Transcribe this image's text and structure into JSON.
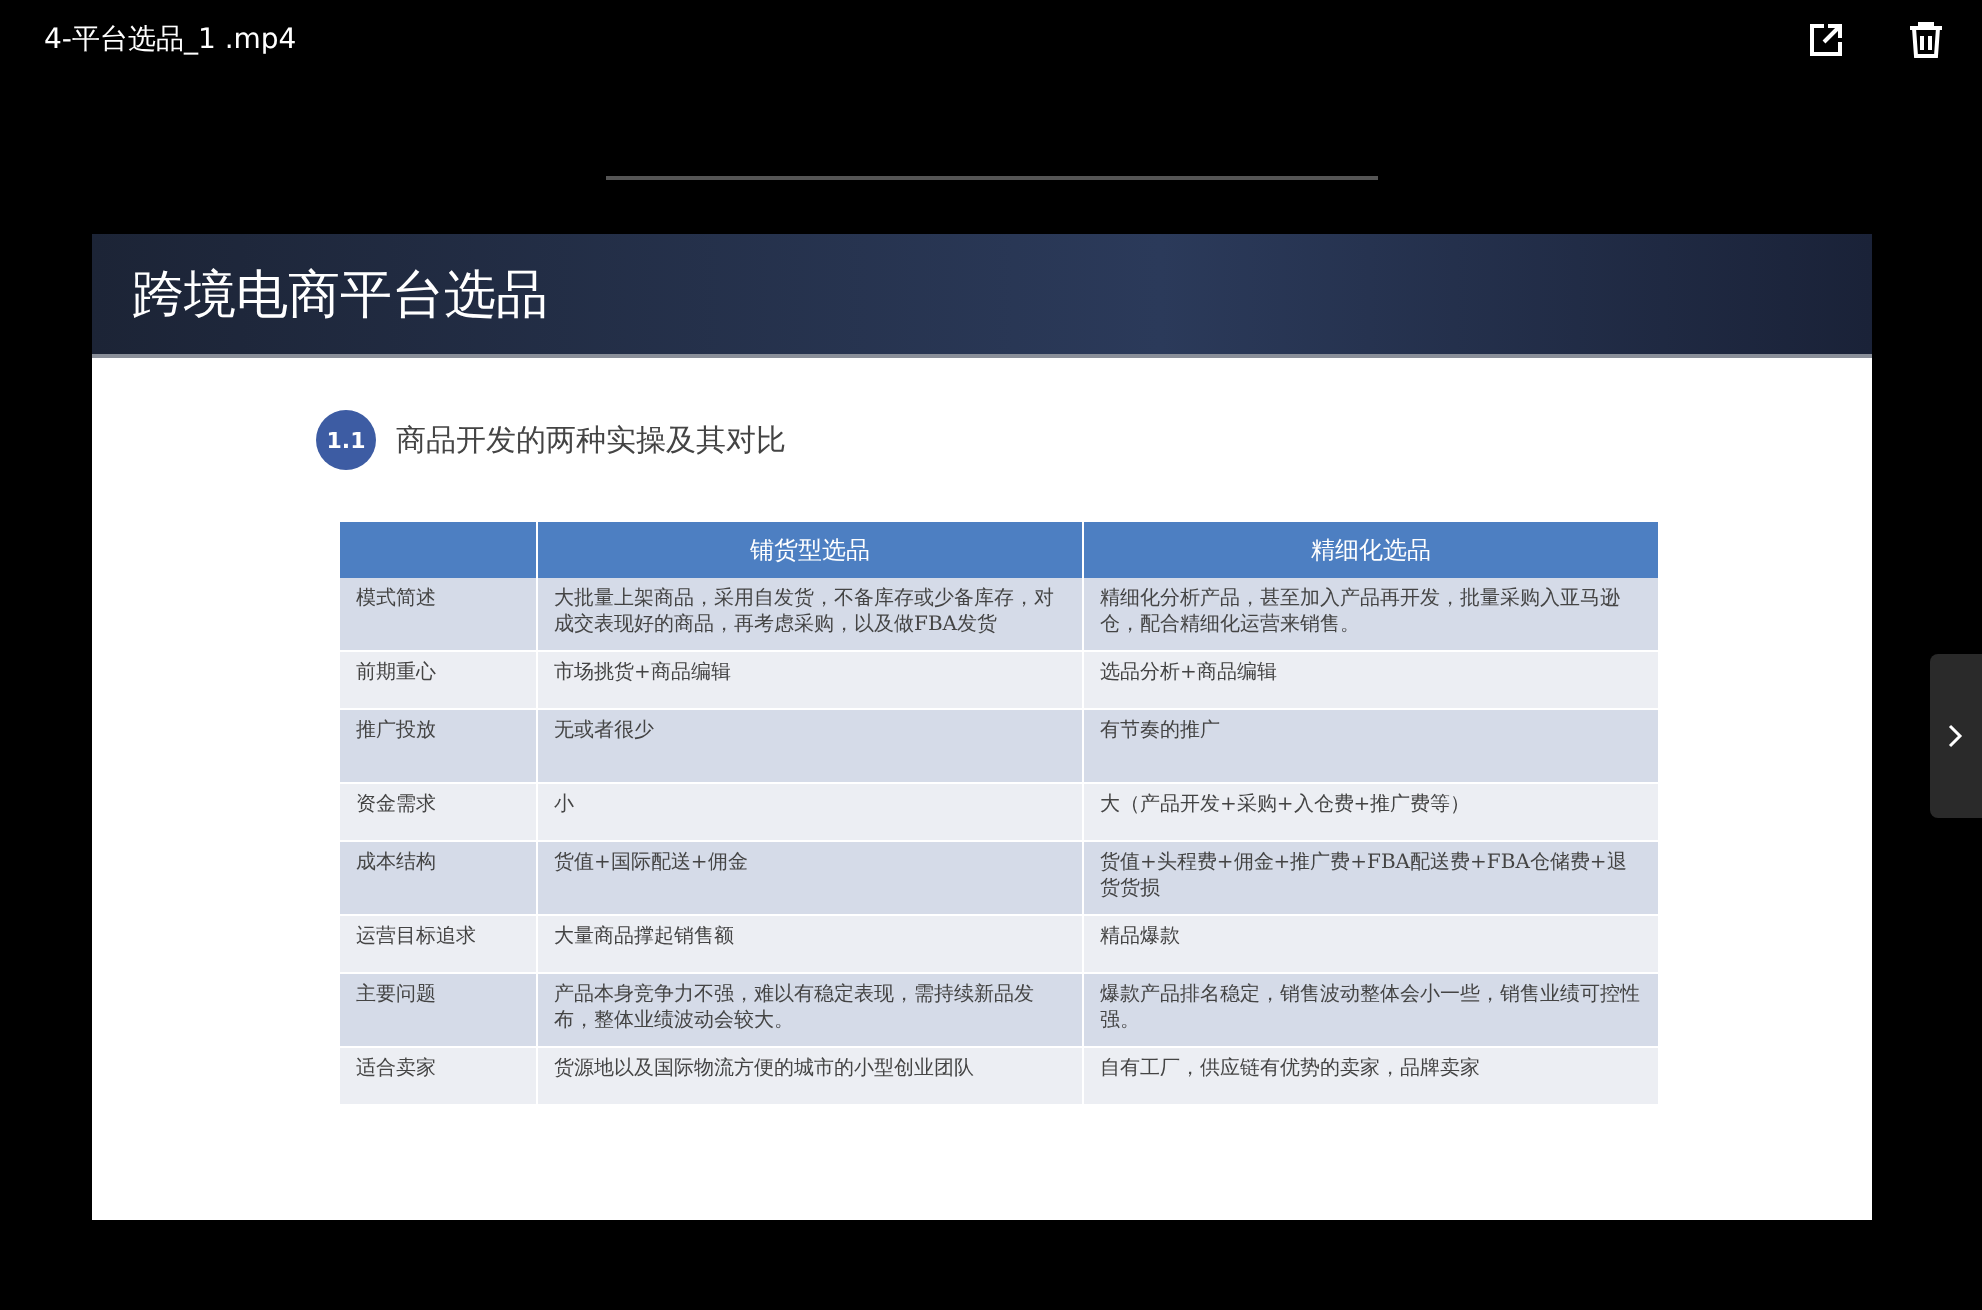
{
  "window": {
    "title": "4-平台选品_1 .mp4"
  },
  "slide": {
    "title": "跨境电商平台选品",
    "section_number": "1.1",
    "section_title": "商品开发的两种实操及其对比",
    "table": {
      "columns": [
        "",
        "铺货型选品",
        "精细化选品"
      ],
      "rows": [
        [
          "模式简述",
          "大批量上架商品，采用自发货，不备库存或少备库存，对成交表现好的商品，再考虑采购，以及做FBA发货",
          "精细化分析产品，甚至加入产品再开发，批量采购入亚马逊仓，配合精细化运营来销售。"
        ],
        [
          "前期重心",
          "市场挑货+商品编辑",
          "选品分析+商品编辑"
        ],
        [
          "推广投放",
          "无或者很少",
          "有节奏的推广"
        ],
        [
          "资金需求",
          "小",
          "大（产品开发+采购+入仓费+推广费等）"
        ],
        [
          "成本结构",
          "货值+国际配送+佣金",
          "货值+头程费+佣金+推广费+FBA配送费+FBA仓储费+退货货损"
        ],
        [
          "运营目标追求",
          "大量商品撑起销售额",
          "精品爆款"
        ],
        [
          "主要问题",
          "产品本身竞争力不强，难以有稳定表现，需持续新品发布，整体业绩波动会较大。",
          "爆款产品排名稳定，销售波动整体会小一些，销售业绩可控性强。"
        ],
        [
          "适合卖家",
          "货源地以及国际物流方便的城市的小型创业团队",
          "自有工厂，供应链有优势的卖家，品牌卖家"
        ]
      ]
    }
  }
}
